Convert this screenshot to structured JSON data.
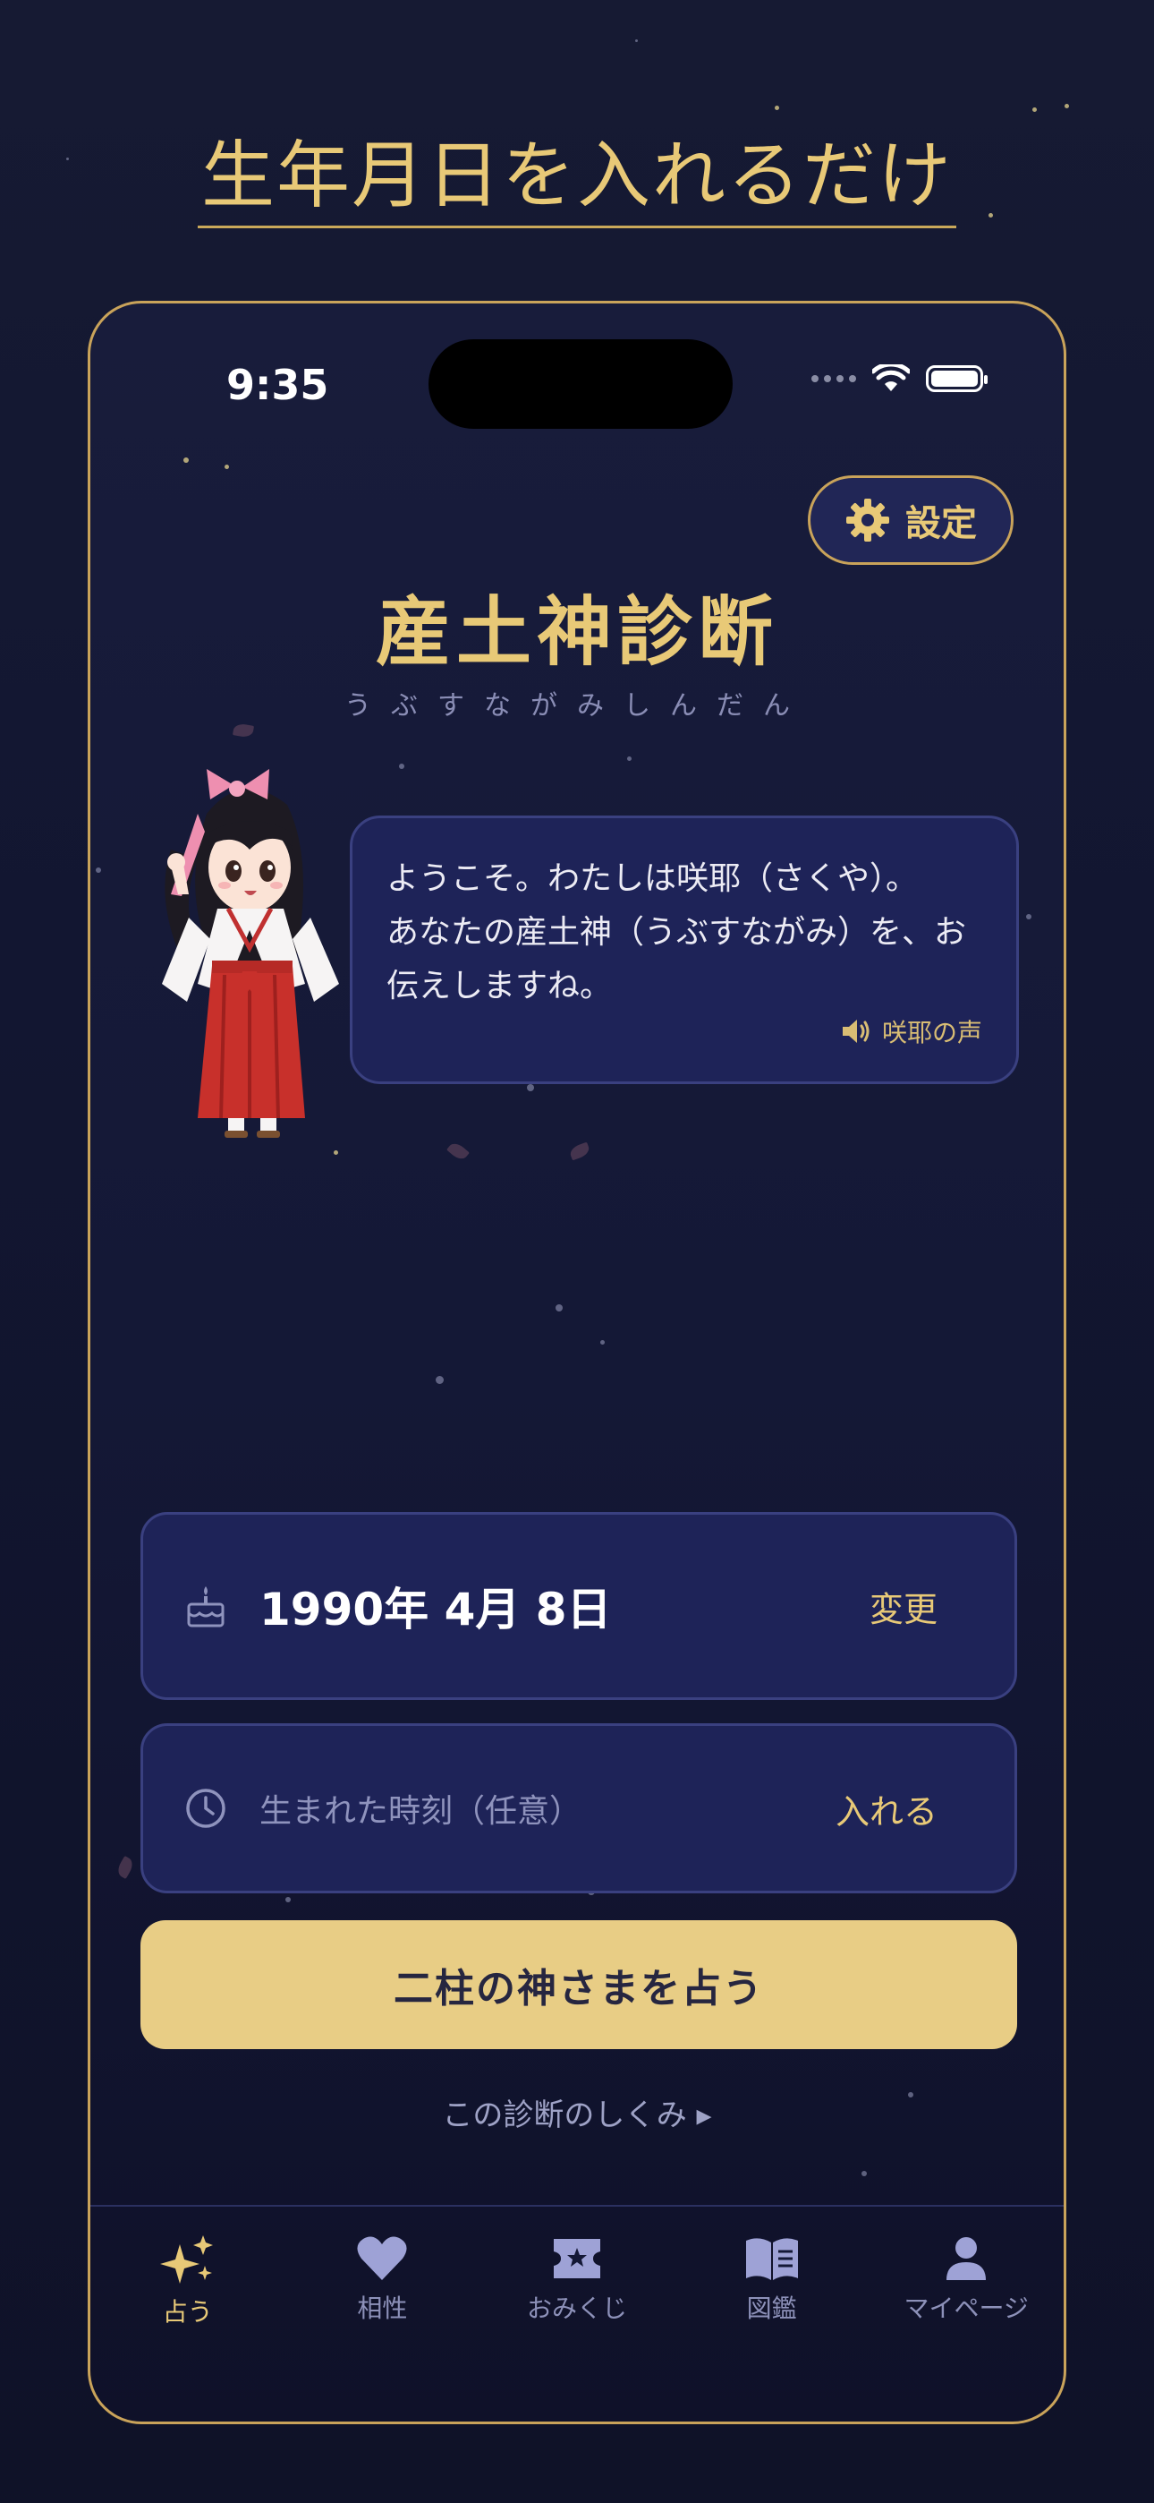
{
  "headline": "生年月日を入れるだけ",
  "status_bar": {
    "time": "9:35"
  },
  "settings": {
    "label": "設定"
  },
  "app": {
    "title": "産土神診断",
    "ruby": "うぶすながみしんだん"
  },
  "bubble": {
    "message": "ようこそ。わたしは咲耶（さくや）。\nあなたの産土神（うぶすながみ）を、お\n伝えしますね。",
    "voice_label": "咲耶の声"
  },
  "birth_card": {
    "date": "1990年 4月 8日",
    "action": "変更",
    "icon": "birthday-cake-icon"
  },
  "time_card": {
    "placeholder": "生まれた時刻（任意）",
    "action": "入れる",
    "icon": "clock-icon"
  },
  "primary_button": {
    "label": "二柱の神さまを占う"
  },
  "how_link": {
    "label": "この診断のしくみ ▸"
  },
  "tabs": [
    {
      "label": "占う",
      "icon": "sparkles-icon",
      "active": true
    },
    {
      "label": "相性",
      "icon": "heart-icon",
      "active": false
    },
    {
      "label": "おみくじ",
      "icon": "ticket-icon",
      "active": false
    },
    {
      "label": "図鑑",
      "icon": "book-icon",
      "active": false
    },
    {
      "label": "マイページ",
      "icon": "person-icon",
      "active": false
    }
  ],
  "colors": {
    "gold": "#e8c977",
    "card_bg": "#1e2358",
    "bg": "#141836",
    "button": "#e8cd85"
  }
}
